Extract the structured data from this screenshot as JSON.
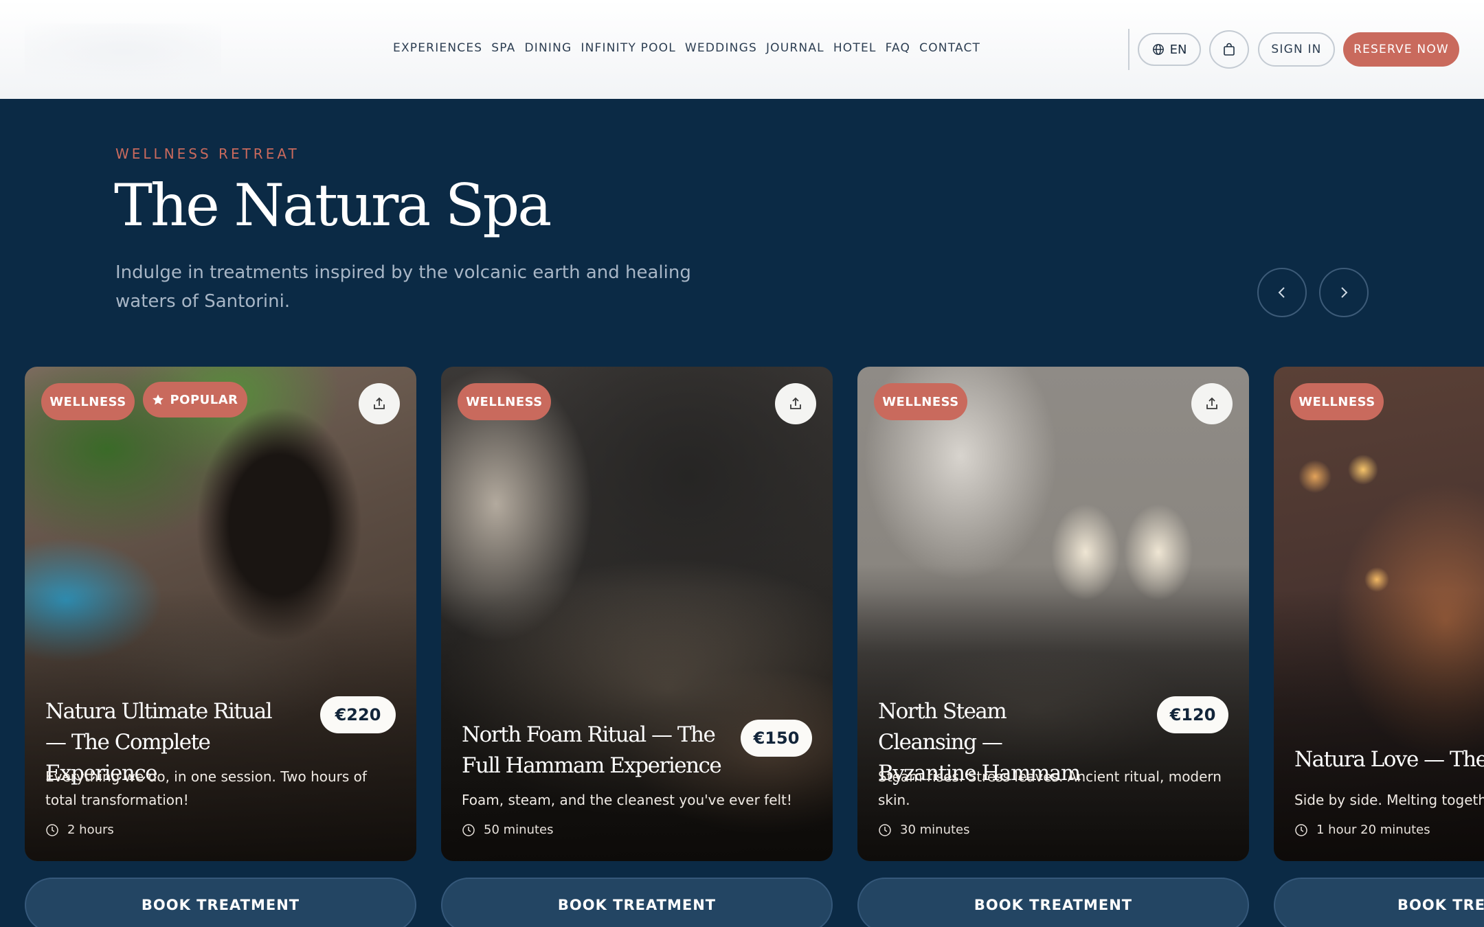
{
  "header": {
    "nav": [
      "EXPERIENCES",
      "SPA",
      "DINING",
      "INFINITY POOL",
      "WEDDINGS",
      "JOURNAL",
      "HOTEL",
      "FAQ",
      "CONTACT"
    ],
    "lang_label": "EN",
    "signin_label": "SIGN IN",
    "reserve_label": "RESERVE NOW",
    "icons": {
      "lang": "globe-icon",
      "cart": "shopping-bag-icon"
    }
  },
  "hero": {
    "eyebrow": "WELLNESS RETREAT",
    "title": "The Natura Spa",
    "subtitle": "Indulge in treatments inspired by the volcanic earth and healing waters of Santorini.",
    "icons": {
      "prev": "chevron-left-icon",
      "next": "chevron-right-icon"
    }
  },
  "cards": [
    {
      "badge": "WELLNESS",
      "popular": "POPULAR",
      "title": "Natura Ultimate Ritual — The Complete Experience",
      "price": "€220",
      "description": "Everything we do, in one session. Two hours of total transformation!",
      "duration": "2 hours",
      "button": "BOOK TREATMENT"
    },
    {
      "badge": "WELLNESS",
      "title": "North Foam Ritual — The Full Hammam Experience",
      "price": "€150",
      "description": "Foam, steam, and the cleanest you've ever felt!",
      "duration": "50 minutes",
      "button": "BOOK TREATMENT"
    },
    {
      "badge": "WELLNESS",
      "title": "North Steam Cleansing — Byzantine Hammam",
      "price": "€120",
      "description": "Steam rises. Stress leaves. Ancient ritual, modern skin.",
      "duration": "30 minutes",
      "button": "BOOK TREATMENT"
    },
    {
      "badge": "WELLNESS",
      "title": "Natura Love — The Cou",
      "description": "Side by side. Melting togeth",
      "duration": "1 hour 20 minutes",
      "button": "BOOK TREA"
    }
  ],
  "colors": {
    "background": "#0b2a45",
    "accent": "#c96a5d",
    "button": "#234563"
  }
}
